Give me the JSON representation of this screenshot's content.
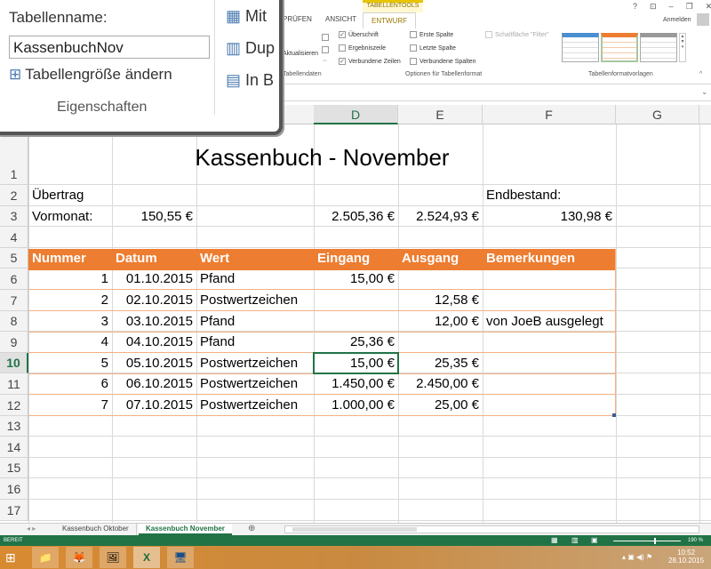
{
  "ribbon": {
    "context_tab": "TABELLENTOOLS",
    "tabs": [
      "PRÜFEN",
      "ANSICHT",
      "ENTWURF"
    ],
    "signin": "Anmelden",
    "refresh": "Aktualisieren",
    "group_data": "Tabellendaten",
    "options": [
      {
        "label": "Überschrift",
        "checked": true
      },
      {
        "label": "Ergebniszeile",
        "checked": false
      },
      {
        "label": "Verbundene Zeilen",
        "checked": true
      },
      {
        "label": "Erste Spalte",
        "checked": false
      },
      {
        "label": "Letzte Spalte",
        "checked": false
      },
      {
        "label": "Verbundene Spalten",
        "checked": false
      },
      {
        "label": "Schaltfläche \"Filter\"",
        "checked": false
      }
    ],
    "group_options": "Optionen für Tabellenformat",
    "group_styles": "Tabellenformatvorlagen",
    "window_controls": [
      "?",
      "⊡",
      "–",
      "❐",
      "✕"
    ]
  },
  "magnifier": {
    "table_name_label": "Tabellenname:",
    "table_name_value": "KassenbuchNov",
    "resize_label": "Tabellengröße ändern",
    "group_label": "Eigenschaften",
    "partial_buttons": [
      "Mit",
      "Dup",
      "In B"
    ]
  },
  "columns": [
    "D",
    "E",
    "F",
    "G"
  ],
  "rows": [
    "1",
    "2",
    "3",
    "4",
    "5",
    "6",
    "7",
    "8",
    "9",
    "10",
    "11",
    "12",
    "13",
    "14",
    "15",
    "16",
    "17"
  ],
  "sheet": {
    "title": "Kassenbuch - November",
    "uebertrag": "Übertrag",
    "vormonat": "Vormonat:",
    "vormonat_value": "150,55 €",
    "endbestand": "Endbestand:",
    "sum_in": "2.505,36 €",
    "sum_out": "2.524,93 €",
    "end_value": "130,98 €",
    "headers": [
      "Nummer",
      "Datum",
      "Wert",
      "Eingang",
      "Ausgang",
      "Bemerkungen"
    ],
    "entries": [
      [
        "1",
        "01.10.2015",
        "Pfand",
        "15,00 €",
        "",
        ""
      ],
      [
        "2",
        "02.10.2015",
        "Postwertzeichen",
        "",
        "12,58 €",
        ""
      ],
      [
        "3",
        "03.10.2015",
        "Pfand",
        "",
        "12,00 €",
        "von JoeB ausgelegt"
      ],
      [
        "4",
        "04.10.2015",
        "Pfand",
        "25,36 €",
        "",
        ""
      ],
      [
        "5",
        "05.10.2015",
        "Postwertzeichen",
        "15,00 €",
        "25,35 €",
        ""
      ],
      [
        "6",
        "06.10.2015",
        "Postwertzeichen",
        "1.450,00 €",
        "2.450,00 €",
        ""
      ],
      [
        "7",
        "07.10.2015",
        "Postwertzeichen",
        "1.000,00 €",
        "25,00 €",
        ""
      ]
    ]
  },
  "sheet_tabs": [
    "Kassenbuch Oktober",
    "Kassenbuch November"
  ],
  "status": {
    "ready": "BEREIT",
    "zoom": "190 %"
  },
  "taskbar": {
    "time": "10:52",
    "date": "28.10.2015"
  }
}
